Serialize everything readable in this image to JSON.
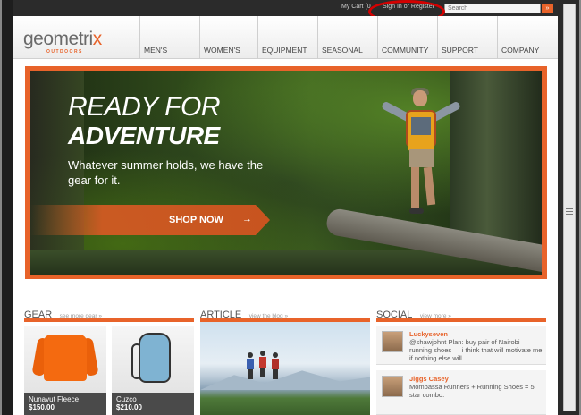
{
  "utility_bar": {
    "cart_label": "My Cart (0",
    "signin_label": "Sign In or Register",
    "search_placeholder": "Search",
    "search_button": "»"
  },
  "brand": {
    "name_main": "geometri",
    "name_x": "x",
    "name_sub": "OUTDOORS"
  },
  "nav": {
    "items": [
      "MEN'S",
      "WOMEN'S",
      "EQUIPMENT",
      "SEASONAL",
      "COMMUNITY",
      "SUPPORT",
      "COMPANY"
    ]
  },
  "hero": {
    "line1": "READY FOR",
    "line2": "ADVENTURE",
    "subtitle": "Whatever summer holds, we have the gear for it.",
    "cta_label": "SHOP NOW",
    "cta_arrow": "→"
  },
  "sections": {
    "gear": {
      "title": "GEAR",
      "link": "see more gear »"
    },
    "article": {
      "title": "ARTICLE",
      "link": "view the blog »"
    },
    "social": {
      "title": "SOCIAL",
      "link": "view more »"
    }
  },
  "gear_items": [
    {
      "name": "Nunavut Fleece",
      "price": "$150.00"
    },
    {
      "name": "Cuzco",
      "price": "$210.00"
    }
  ],
  "social_posts": [
    {
      "user": "Luckyseven",
      "text": "@shawjohnt Plan: buy pair of Nairobi running shoes — i think that will motivate me if nothing else will."
    },
    {
      "user": "Jiggs Casey",
      "text": "Mombassa Runners + Running Shoes = 5 star combo."
    }
  ],
  "colors": {
    "accent": "#e8632a",
    "utility_bar": "#2b2b2b",
    "annotation_oval": "#d40000"
  }
}
